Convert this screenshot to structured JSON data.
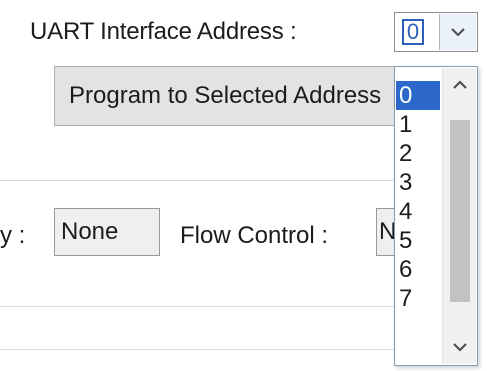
{
  "uart": {
    "label": "UART Interface Address :",
    "selected_value": "0"
  },
  "program_button": {
    "label": "Program to Selected Address"
  },
  "serial": {
    "parity_label_tail": "y :",
    "parity_value": "None",
    "flow_label": "Flow Control :",
    "flow_value": "None"
  },
  "dropdown": {
    "options": [
      "0",
      "1",
      "2",
      "3",
      "4",
      "5",
      "6",
      "7"
    ],
    "selected_index": 0
  },
  "icons": {
    "combo_arrow": "chevron-down-icon",
    "scroll_up": "chevron-up-icon",
    "scroll_down": "chevron-down-icon"
  },
  "colors": {
    "selection": "#2c68c9",
    "focus": "#2c5fbd"
  }
}
